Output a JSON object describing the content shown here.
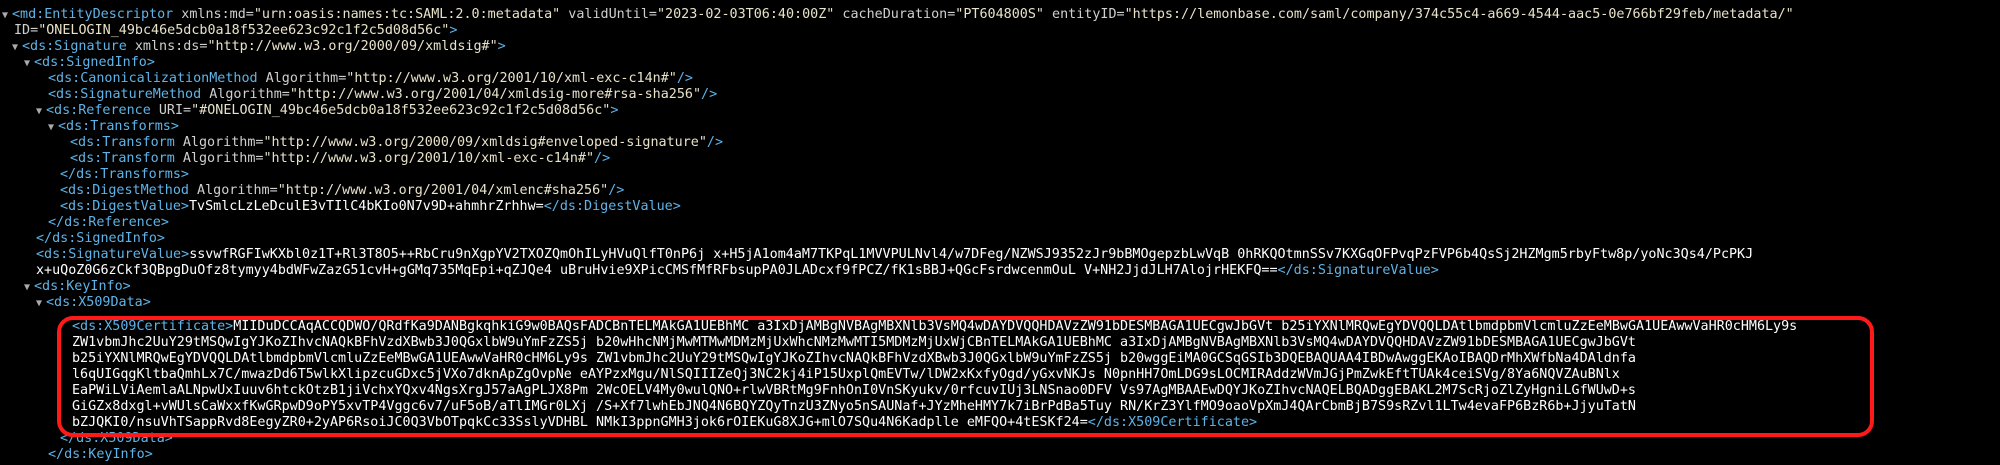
{
  "accent_color": "#5fb3e8",
  "highlight_color": "#ff1a1a",
  "icons": {
    "expand": "triangle-down-icon"
  },
  "tokens": {
    "entity_open": "<md:EntityDescriptor",
    "ns_md_attr": " xmlns:md=",
    "ns_md_val": "\"urn:oasis:names:tc:SAML:2.0:metadata\"",
    "valid_attr": " validUntil=",
    "valid_val": "\"2023-02-03T06:40:00Z\"",
    "cache_attr": " cacheDuration=",
    "cache_val": "\"PT604800S\"",
    "entity_attr": " entityID=",
    "entity_val": "\"https://lemonbase.com/saml/company/374c55c4-a669-4544-aac5-0e766bf29feb/metadata/\"",
    "id_attr": "ID=",
    "id_val": "\"ONELOGIN_49bc46e5dcb0a18f532ee623c92c1f2c5d08d56c\"",
    "close_gt": ">",
    "close_self": "/>",
    "sig_open": "<ds:Signature",
    "ns_ds_attr": " xmlns:ds=",
    "ns_ds_val": "\"http://www.w3.org/2000/09/xmldsig#\"",
    "signedinfo_open": "<ds:SignedInfo>",
    "canon_open": "<ds:CanonicalizationMethod",
    "alg_attr": " Algorithm=",
    "canon_val": "\"http://www.w3.org/2001/10/xml-exc-c14n#\"",
    "sigmethod_open": "<ds:SignatureMethod",
    "sigmethod_val": "\"http://www.w3.org/2001/04/xmldsig-more#rsa-sha256\"",
    "ref_open": "<ds:Reference",
    "uri_attr": " URI=",
    "uri_val": "\"#ONELOGIN_49bc46e5dcb0a18f532ee623c92c1f2c5d08d56c\"",
    "transforms_open": "<ds:Transforms>",
    "transform_open": "<ds:Transform",
    "transform1_val": "\"http://www.w3.org/2000/09/xmldsig#enveloped-signature\"",
    "transform2_val": "\"http://www.w3.org/2001/10/xml-exc-c14n#\"",
    "transforms_close": "</ds:Transforms>",
    "digestmethod_open": "<ds:DigestMethod",
    "digestmethod_val": "\"http://www.w3.org/2001/04/xmlenc#sha256\"",
    "digestvalue_open": "<ds:DigestValue>",
    "digestvalue_text": "TvSmlcLzLeDculE3vTIlC4bKIo0N7v9D+ahmhrZrhhw=",
    "digestvalue_close": "</ds:DigestValue>",
    "ref_close": "</ds:Reference>",
    "signedinfo_close": "</ds:SignedInfo>",
    "sigvalue_open": "<ds:SignatureValue>",
    "sigvalue_text_1": "ssvwfRGFIwKXbl0z1T+Rl3T8O5++RbCru9nXgpYV2TXOZQmOhILyHVuQlfT0nP6j x+H5jA1om4aM7TKPqL1MVVPULNvl4/w7DFeg/NZWSJ9352zJr9bBMOgepzbLwVqB 0hRKQOtmnSSv7KXGqOFPvqPzFVP6b4QsSj2HZMgm5rbyFtw8p/yoNc3Qs4/PcPKJ",
    "sigvalue_text_2": "x+uQoZ0G6zCkf3QBpgDuOfz8tymyy4bdWFwZazG51cvH+gGMq735MqEpi+qZJQe4 uBruHvie9XPicCMSfMfRFbsupPA0JLADcxf9fPCZ/fK1sBBJ+QGcFsrdwcenmOuL V+NH2JjdJLH7AlojrHEKFQ==",
    "sigvalue_close": "</ds:SignatureValue>",
    "keyinfo_open": "<ds:KeyInfo>",
    "x509data_open": "<ds:X509Data>",
    "cert_open": "<ds:X509Certificate>",
    "cert_1": "MIIDuDCCAqACCQDWO/QRdfKa9DANBgkqhkiG9w0BAQsFADCBnTELMAkGA1UEBhMC a3IxDjAMBgNVBAgMBXNlb3VsMQ4wDAYDVQQHDAVzZW91bDESMBAGA1UECgwJbGVt b25iYXNlMRQwEgYDVQQLDAtlbmdpbmVlcmluZzEeMBwGA1UEAwwVaHR0cHM6Ly9s",
    "cert_2": "ZW1vbmJhc2UuY29tMSQwIgYJKoZIhvcNAQkBFhVzdXBwb3J0QGxlbW9uYmFzZS5j b20wHhcNMjMwMTMwMDMzMjUxWhcNMzMwMTI5MDMzMjUxWjCBnTELMAkGA1UEBhMC a3IxDjAMBgNVBAgMBXNlb3VsMQ4wDAYDVQQHDAVzZW91bDESMBAGA1UECgwJbGVt",
    "cert_3": "b25iYXNlMRQwEgYDVQQLDAtlbmdpbmVlcmluZzEeMBwGA1UEAwwVaHR0cHM6Ly9s ZW1vbmJhc2UuY29tMSQwIgYJKoZIhvcNAQkBFhVzdXBwb3J0QGxlbW9uYmFzZS5j b20wggEiMA0GCSqGSIb3DQEBAQUAA4IBDwAwggEKAoIBAQDrMhXWfbNa4DAldnfa",
    "cert_4": "l6qUIGqgKltbaQmhLx7C/mwazDd6T5wlkXlipzcuGDxc5jVXo7dknApZgOvpNe eAYPzxMgu/NlSQIIIZeQj3NC2kj4iP15UxplQmEVTw/lDW2xKxfyOgd/yGxvNKJs N0pnHH7OmLDG9sLOCMIRAddzWVmJGjPmZwkEftTUAk4ceiSVg/8Ya6NQVZAuBNlx",
    "cert_5": "EaPWiLViAemlaALNpwUxIuuv6htckOtzB1jiVchxYQxv4NgsXrgJ57aAgPLJX8Pm 2WcOELV4My0wulQNO+rlwVBRtMg9FnhOnI0VnSKyukv/0rfcuvIUj3LNSnao0DFV Vs97AgMBAAEwDQYJKoZIhvcNAQELBQADggEBAKL2M7ScRjoZlZyHgniLGfWUwD+s",
    "cert_6": "GiGZx8dxgl+vWUlsCaWxxfKwGRpwD9oPY5xvTP4Vggc6v7/uF5oB/aTlIMGr0LXj /S+Xf7lwhEbJNQ4N6BQYZQyTnzU3ZNyo5nSAUNaf+JYzMheHMY7k7iBrPdBa5Tuy RN/KrZ3YlfMO9oaoVpXmJ4QArCbmBjB7S9sRZvl1LTw4evaFP6BzR6b+JjyuTatN",
    "cert_7": "bZJQKI0/nsuVhTSappRvd8EegyZR0+2yAP6RsoiJC0Q3VbOTpqkCc33SslyVDHBL NMkI3ppnGMH3jok6rOIEKuG8XJG+mlO7SQu4N6Kadplle eMFQO+4tESKf24=",
    "cert_close": "</ds:X509Certificate>",
    "x509data_close": "</ds:X509Data>",
    "keyinfo_close": "</ds:KeyInfo>"
  }
}
